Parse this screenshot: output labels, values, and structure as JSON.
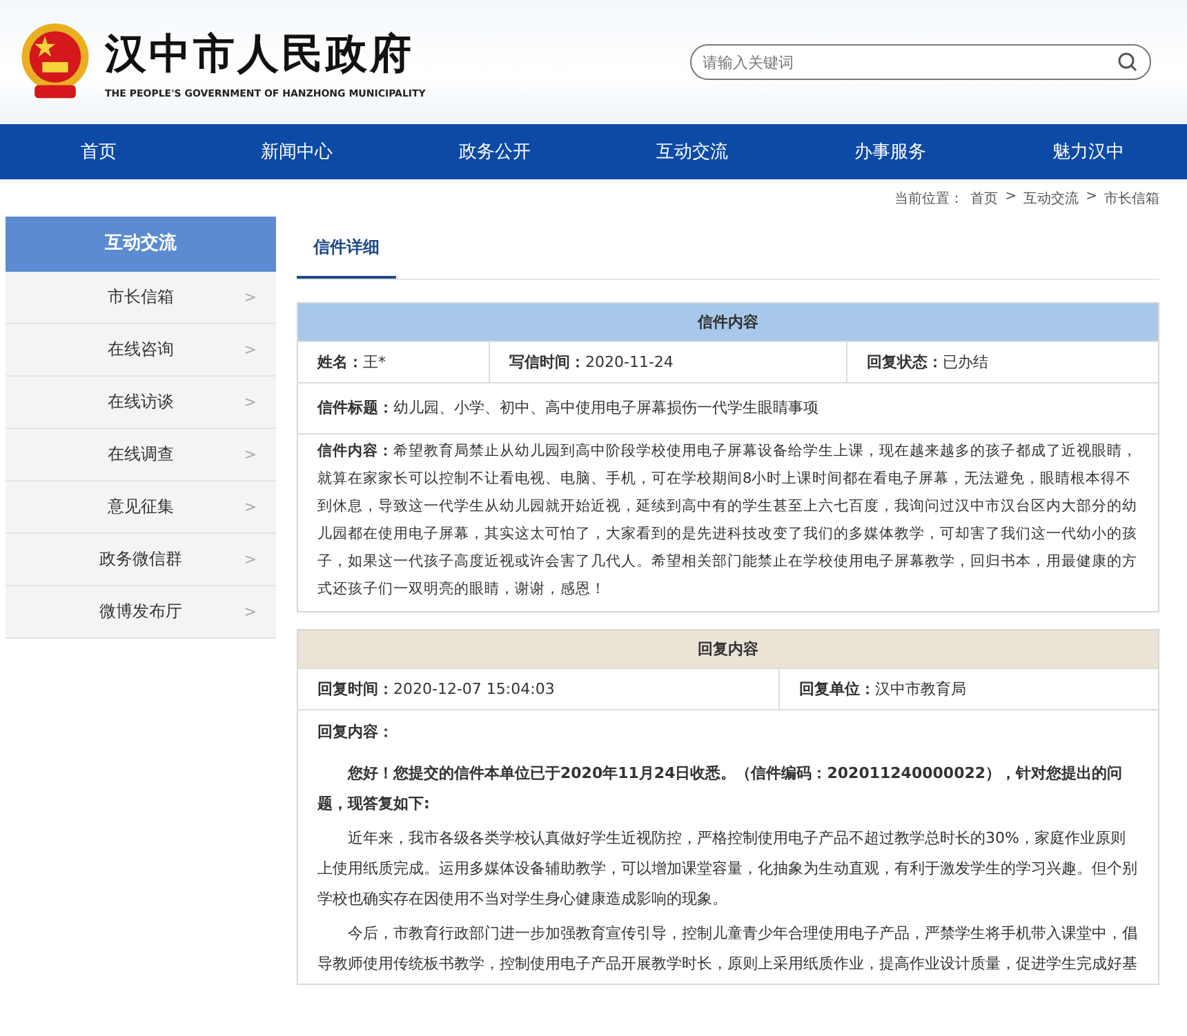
{
  "header": {
    "title": "汉中市人民政府",
    "subtitle": "THE PEOPLE'S GOVERNMENT OF HANZHONG MUNICIPALITY",
    "search": {
      "placeholder": "请输入关键词"
    }
  },
  "nav": [
    {
      "label": "首页"
    },
    {
      "label": "新闻中心"
    },
    {
      "label": "政务公开"
    },
    {
      "label": "互动交流"
    },
    {
      "label": "办事服务"
    },
    {
      "label": "魅力汉中"
    }
  ],
  "breadcrumb": {
    "label": "当前位置：",
    "items": [
      "首页",
      "互动交流",
      "市长信箱"
    ],
    "separator": ">"
  },
  "sidebar": {
    "title": "互动交流",
    "items": [
      {
        "label": "市长信箱",
        "chevron": ">"
      },
      {
        "label": "在线咨询",
        "chevron": ">"
      },
      {
        "label": "在线访谈",
        "chevron": ">"
      },
      {
        "label": "在线调查",
        "chevron": ">"
      },
      {
        "label": "意见征集",
        "chevron": ">"
      },
      {
        "label": "政务微信群",
        "chevron": ">"
      },
      {
        "label": "微博发布厅",
        "chevron": ">"
      }
    ]
  },
  "tabs": [
    {
      "label": "信件详细",
      "selected": true
    }
  ],
  "letter": {
    "heading": "信件内容",
    "fields": [
      "**姓名：**王*",
      "**写信时间：**2020-11-24",
      "**回复状态：**已办结"
    ],
    "subject": "**信件标题：**幼儿园、小学、初中、高中使用电子屏幕损伤一代学生眼睛事项",
    "content": "**信件内容：**希望教育局禁止从幼儿园到高中阶段学校使用电子屏幕设备给学生上课，现在越来越多的孩子都成了近视眼睛，就算在家家长可以控制不让看电视、电脑、手机，可在学校期间8小时上课时间都在看电子屏幕，无法避免，眼睛根本得不到休息，导致这一代学生从幼儿园就开始近视，延续到高中有的学生甚至上六七百度，我询问过汉中市汉台区内大部分的幼儿园都在使用电子屏幕，其实这太可怕了，大家看到的是先进科技改变了我们的多媒体教学，可却害了我们这一代幼小的孩子，如果这一代孩子高度近视或许会害了几代人。希望相关部门能禁止在学校使用电子屏幕教学，回归书本，用最健康的方式还孩子们一双明亮的眼睛，谢谢，感恩！"
  },
  "reply": {
    "heading": "回复内容",
    "fields": [
      "**回复时间：**2020-12-07 15:04:03",
      "**回复单位：**汉中市教育局"
    ],
    "label": "回复内容：",
    "paragraphs": [
      {
        "text": "您好！您提交的信件本单位已于2020年11月24日收悉。（信件编码：202011240000022），针对您提出的问题，现答复如下:",
        "bold": true
      },
      {
        "text": "近年来，我市各级各类学校认真做好学生近视防控，严格控制使用电子产品不超过教学总时长的30%，家庭作业原则上使用纸质完成。运用多媒体设备辅助教学，可以增加课堂容量，化抽象为生动直观，有利于激发学生的学习兴趣。但个别学校也确实存在因使用不当对学生身心健康造成影响的现象。",
        "bold": false
      },
      {
        "text": "今后，市教育行政部门进一步加强教育宣传引导，控制儿童青少年合理使用电子产品，严禁学生将手机带入课堂中，倡导教师使用传统板书教学，控制使用电子产品开展教学时长，原则上采用纸质作业，提高作业设计质量，促进学生完成好基",
        "bold": false
      }
    ]
  }
}
